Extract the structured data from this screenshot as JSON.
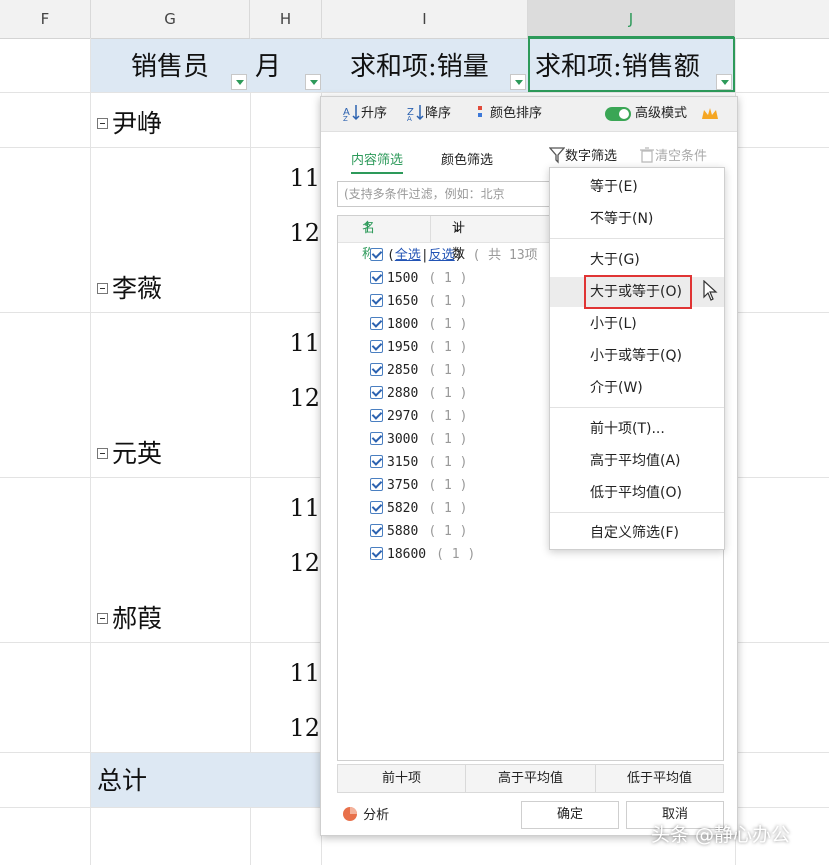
{
  "columns": [
    "F",
    "G",
    "H",
    "I",
    "J"
  ],
  "pivot_headers": {
    "salesperson": "销售员",
    "month": "月",
    "sum_qty": "求和项:销量",
    "sum_amount": "求和项:销售额"
  },
  "groups": [
    {
      "name": "尹峥",
      "months": [
        "11",
        "12"
      ]
    },
    {
      "name": "李薇",
      "months": [
        "11",
        "12"
      ]
    },
    {
      "name": "元英",
      "months": [
        "11",
        "12"
      ]
    },
    {
      "name": "郝葭",
      "months": [
        "11",
        "12"
      ]
    }
  ],
  "total_label": "总计",
  "panel": {
    "toolbar": {
      "sort_asc": "升序",
      "sort_desc": "降序",
      "color_sort": "颜色排序",
      "advanced_mode": "高级模式"
    },
    "tabs": {
      "content_filter": "内容筛选",
      "color_filter": "颜色筛选",
      "number_filter": "数字筛选",
      "clear_conditions": "清空条件"
    },
    "search_placeholder": "(支持多条件过滤，例如：北京",
    "list_headers": {
      "name": "名称",
      "count": "计数"
    },
    "select_all": {
      "all": "全选",
      "invert": "反选",
      "total": "( 共 13项"
    },
    "items": [
      {
        "value": "1500",
        "count": "( 1 )"
      },
      {
        "value": "1650",
        "count": "( 1 )"
      },
      {
        "value": "1800",
        "count": "( 1 )"
      },
      {
        "value": "1950",
        "count": "( 1 )"
      },
      {
        "value": "2850",
        "count": "( 1 )"
      },
      {
        "value": "2880",
        "count": "( 1 )"
      },
      {
        "value": "2970",
        "count": "( 1 )"
      },
      {
        "value": "3000",
        "count": "( 1 )"
      },
      {
        "value": "3150",
        "count": "( 1 )"
      },
      {
        "value": "3750",
        "count": "( 1 )"
      },
      {
        "value": "5820",
        "count": "( 1 )"
      },
      {
        "value": "5880",
        "count": "( 1 )"
      },
      {
        "value": "18600",
        "count": "( 1 )"
      }
    ],
    "bottom_tabs": [
      "前十项",
      "高于平均值",
      "低于平均值"
    ],
    "analysis": "分析",
    "ok": "确定",
    "cancel": "取消"
  },
  "number_filter_menu": [
    "等于(E)",
    "不等于(N)",
    "大于(G)",
    "大于或等于(O)",
    "小于(L)",
    "小于或等于(Q)",
    "介于(W)",
    "前十项(T)...",
    "高于平均值(A)",
    "低于平均值(O)",
    "自定义筛选(F)"
  ],
  "watermark": "头条 @静心办公",
  "colors": {
    "accent_green": "#2d9a5a",
    "highlight_red": "#e03434",
    "header_blue": "#dde8f3"
  }
}
